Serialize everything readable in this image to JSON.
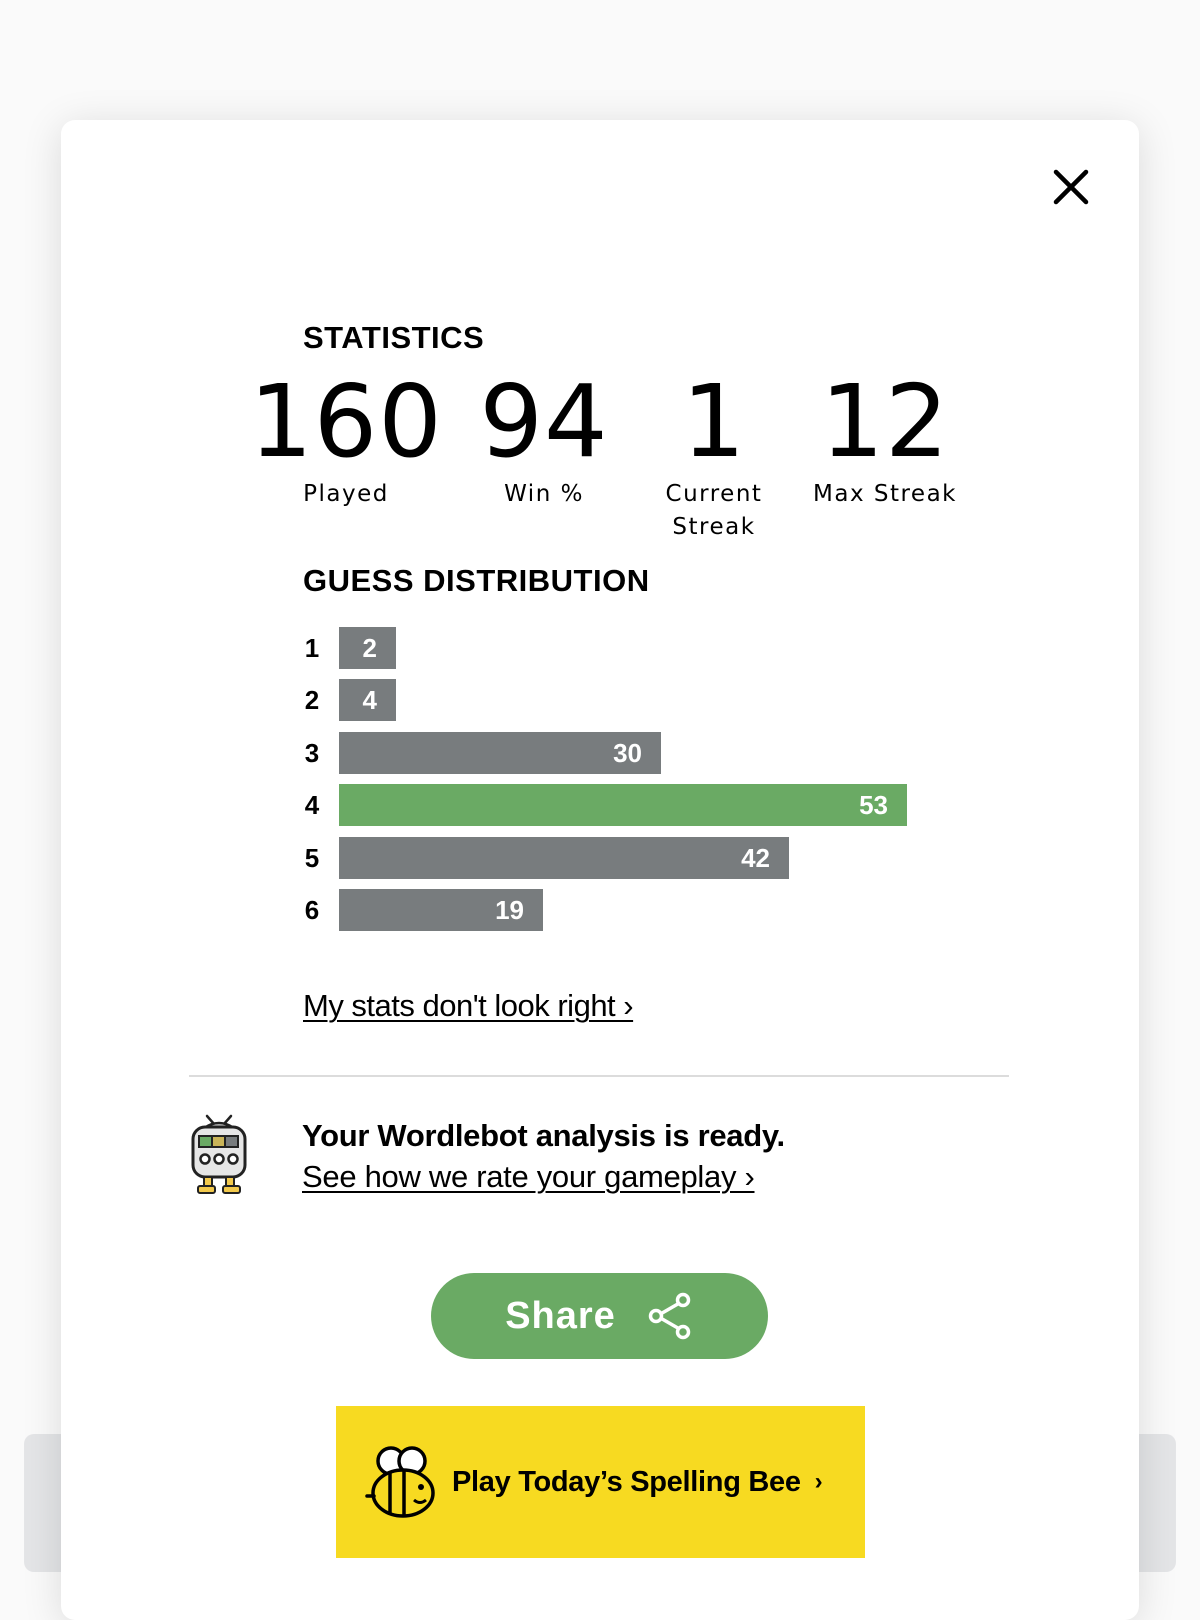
{
  "statistics": {
    "title": "STATISTICS",
    "items": [
      {
        "value": "160",
        "label": "Played"
      },
      {
        "value": "94",
        "label": "Win %"
      },
      {
        "value": "1",
        "label": "Current Streak"
      },
      {
        "value": "12",
        "label": "Max Streak"
      }
    ]
  },
  "distribution": {
    "title": "GUESS DISTRIBUTION",
    "highlight_guess": "4",
    "rows": [
      {
        "guess": "1",
        "count": "2"
      },
      {
        "guess": "2",
        "count": "4"
      },
      {
        "guess": "3",
        "count": "30"
      },
      {
        "guess": "4",
        "count": "53"
      },
      {
        "guess": "5",
        "count": "42"
      },
      {
        "guess": "6",
        "count": "19"
      }
    ]
  },
  "stats_link": "My stats don't look right ›",
  "wordlebot": {
    "title": "Your Wordlebot analysis is ready.",
    "link": "See how we rate your gameplay ›"
  },
  "share": {
    "label": "Share",
    "icon": "share-icon"
  },
  "spelling_bee": {
    "label": "Play Today’s Spelling Bee",
    "chevron": "›",
    "icon": "bee-icon"
  },
  "close": {
    "icon": "close-icon"
  },
  "colors": {
    "gray_bar": "#787c7e",
    "green": "#6aaa64",
    "bee_yellow": "#f7da21"
  }
}
